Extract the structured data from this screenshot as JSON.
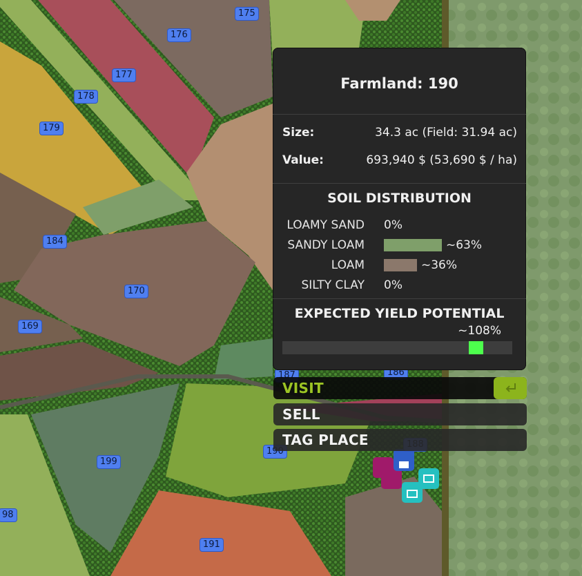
{
  "map": {
    "field_labels": [
      "175",
      "176",
      "177",
      "178",
      "179",
      "184",
      "170",
      "169",
      "187",
      "186",
      "188",
      "190",
      "199",
      "191",
      "98"
    ]
  },
  "panel": {
    "title": "Farmland: 190",
    "size_label": "Size:",
    "size_value": "34.3 ac (Field: 31.94 ac)",
    "value_label": "Value:",
    "value_value": "693,940 $ (53,690 $ / ha)",
    "soil_title": "SOIL DISTRIBUTION",
    "soil": [
      {
        "name": "LOAMY SAND",
        "pct": "0%",
        "fraction": 0.0,
        "color": "#a89a60"
      },
      {
        "name": "SANDY LOAM",
        "pct": "~63%",
        "fraction": 0.63,
        "color": "#7f9f6a"
      },
      {
        "name": "LOAM",
        "pct": "~36%",
        "fraction": 0.36,
        "color": "#8b786b"
      },
      {
        "name": "SILTY CLAY",
        "pct": "0%",
        "fraction": 0.0,
        "color": "#6a6a6a"
      }
    ],
    "yield_title": "EXPECTED YIELD POTENTIAL",
    "yield_pct": "~108%",
    "yield_fraction": 0.84
  },
  "actions": {
    "visit": "VISIT",
    "sell": "SELL",
    "tag": "TAG PLACE",
    "visit_key_icon": "enter-key-icon"
  },
  "colors": {
    "accent": "#8cb41c",
    "yield_marker": "#4dff4d"
  }
}
